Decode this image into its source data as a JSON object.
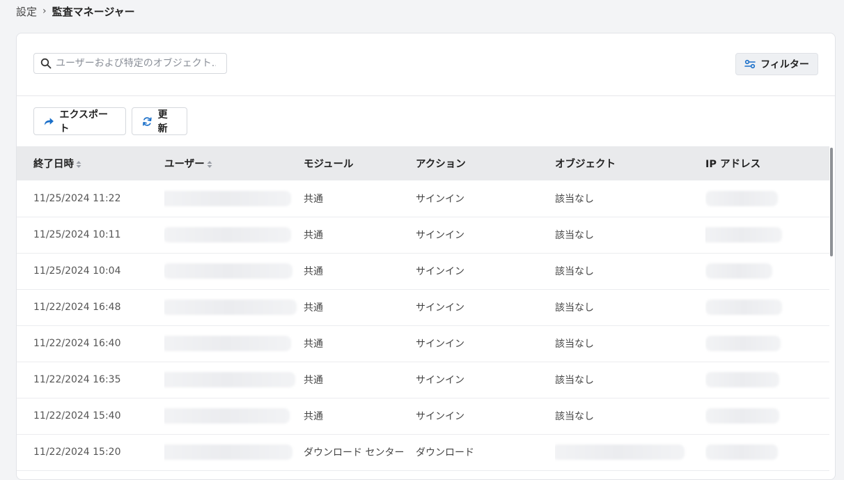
{
  "breadcrumb": {
    "parent": "設定",
    "current": "監査マネージャー"
  },
  "search": {
    "placeholder": "ユーザーおよび特定のオブジェクト..."
  },
  "toolbar": {
    "filter_label": "フィルター",
    "export_label": "エクスポート",
    "refresh_label": "更新"
  },
  "table": {
    "columns": [
      "終了日時",
      "ユーザー",
      "モジュール",
      "アクション",
      "オブジェクト",
      "IP アドレス"
    ],
    "rows": [
      {
        "datetime": "11/25/2024 11:22",
        "module": "共通",
        "action": "サインイン",
        "object": "該当なし"
      },
      {
        "datetime": "11/25/2024 10:11",
        "module": "共通",
        "action": "サインイン",
        "object": "該当なし"
      },
      {
        "datetime": "11/25/2024 10:04",
        "module": "共通",
        "action": "サインイン",
        "object": "該当なし"
      },
      {
        "datetime": "11/22/2024 16:48",
        "module": "共通",
        "action": "サインイン",
        "object": "該当なし"
      },
      {
        "datetime": "11/22/2024 16:40",
        "module": "共通",
        "action": "サインイン",
        "object": "該当なし"
      },
      {
        "datetime": "11/22/2024 16:35",
        "module": "共通",
        "action": "サインイン",
        "object": "該当なし"
      },
      {
        "datetime": "11/22/2024 15:40",
        "module": "共通",
        "action": "サインイン",
        "object": "該当なし"
      },
      {
        "datetime": "11/22/2024 15:20",
        "module": "ダウンロード センター",
        "action": "ダウンロード",
        "object": ""
      }
    ]
  },
  "colors": {
    "accent": "#1a6fc9",
    "header_bg": "#e9eaec"
  },
  "icons": {
    "search": "search-icon",
    "filter": "sliders-icon",
    "export": "share-arrow-icon",
    "refresh": "refresh-icon",
    "sort": "sort-icon"
  }
}
